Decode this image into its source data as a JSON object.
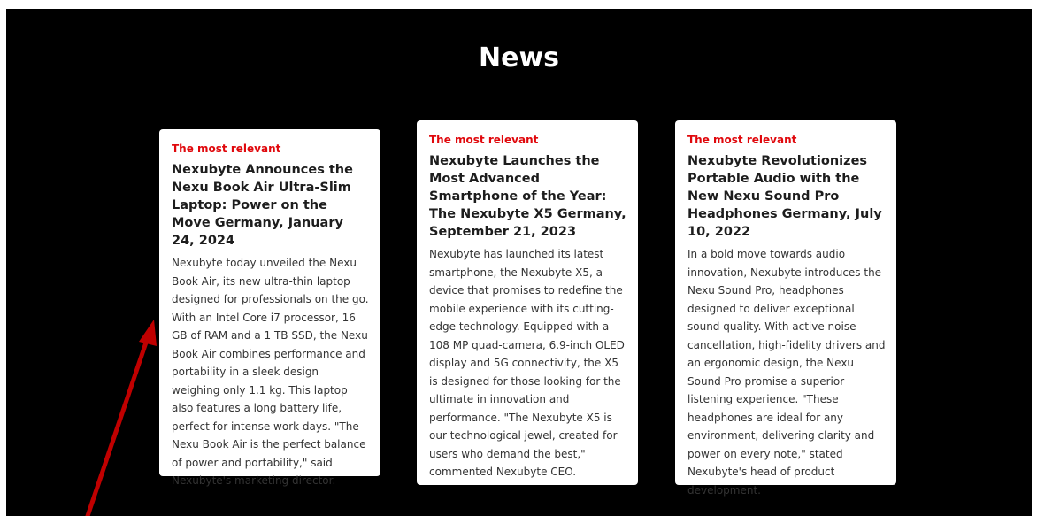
{
  "page": {
    "title": "News"
  },
  "cards": [
    {
      "tag": "The most relevant",
      "headline": "Nexubyte Announces the Nexu Book Air Ultra-Slim Laptop: Power on the Move Germany, January 24, 2024",
      "body": "Nexubyte today unveiled the Nexu Book Air, its new ultra-thin laptop designed for professionals on the go. With an Intel Core i7 processor, 16 GB of RAM and a 1 TB SSD, the Nexu Book Air combines performance and portability in a sleek design weighing only 1.1 kg. This laptop also features a long battery life, perfect for intense work days. \"The Nexu Book Air is the perfect balance of power and portability,\" said Nexubyte's marketing director."
    },
    {
      "tag": "The most relevant",
      "headline": "Nexubyte Launches the Most Advanced Smartphone of the Year: The Nexubyte X5 Germany, September 21, 2023",
      "body": "Nexubyte has launched its latest smartphone, the Nexubyte X5, a device that promises to redefine the mobile experience with its cutting-edge technology. Equipped with a 108 MP quad-camera, 6.9-inch OLED display and 5G connectivity, the X5 is designed for those looking for the ultimate in innovation and performance. \"The Nexubyte X5 is our technological jewel, created for users who demand the best,\" commented Nexubyte CEO."
    },
    {
      "tag": "The most relevant",
      "headline": "Nexubyte Revolutionizes Portable Audio with the New Nexu Sound Pro Headphones Germany, July 10, 2022",
      "body": "In a bold move towards audio innovation, Nexubyte introduces the Nexu Sound Pro, headphones designed to deliver exceptional sound quality. With active noise cancellation, high-fidelity drivers and an ergonomic design, the Nexu Sound Pro promise a superior listening experience. \"These headphones are ideal for any environment, delivering clarity and power on every note,\" stated Nexubyte's head of product development."
    }
  ],
  "colors": {
    "background": "#000000",
    "card_background": "#ffffff",
    "tag": "#e0080c",
    "arrow": "#c00000"
  },
  "annotation": {
    "icon": "red-arrow-icon"
  }
}
